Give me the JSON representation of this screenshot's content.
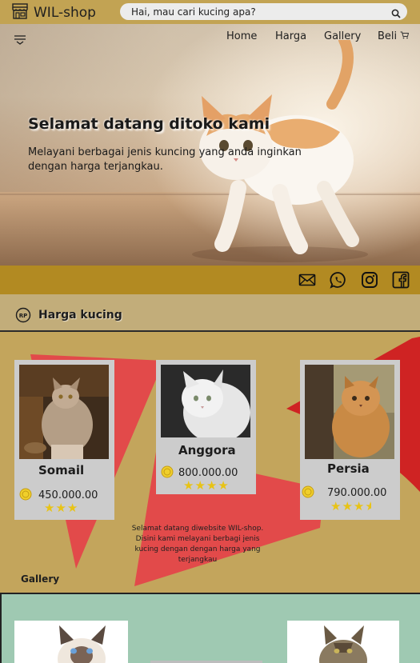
{
  "header": {
    "brand": "WIL-shop",
    "search_placeholder": "Hai, mau cari kucing apa?"
  },
  "nav": {
    "items": [
      "Home",
      "Harga",
      "Gallery",
      "Beli"
    ]
  },
  "hero": {
    "title": "Selamat datang ditoko kami",
    "text": "Melayani berbagai jenis kuncing yang anda inginkan dengan harga terjangkau."
  },
  "social": {
    "icons": [
      "mail-icon",
      "whatsapp-icon",
      "instagram-icon",
      "facebook-icon"
    ]
  },
  "pricing": {
    "title": "Harga kucing",
    "currency_badge": "RP",
    "cards": [
      {
        "name": "Somail",
        "price": "450.000.00",
        "rating": 3
      },
      {
        "name": "Anggora",
        "price": "800.000.00",
        "rating": 4
      },
      {
        "name": "Persia",
        "price": "790.000.00",
        "rating": 3.5
      }
    ],
    "welcome": "Selamat datang diwebsite WIL-shop. Disini kami melayani berbagi jenis kucing dengan dengan harga yang terjangkau"
  },
  "gallery": {
    "title": "Gallery"
  },
  "colors": {
    "topbar": "#c2a353",
    "social_bar": "#b28a22",
    "triangle_red": "#e24a4a",
    "gallery_bg": "#9fc9b2",
    "star": "#e8c315"
  }
}
